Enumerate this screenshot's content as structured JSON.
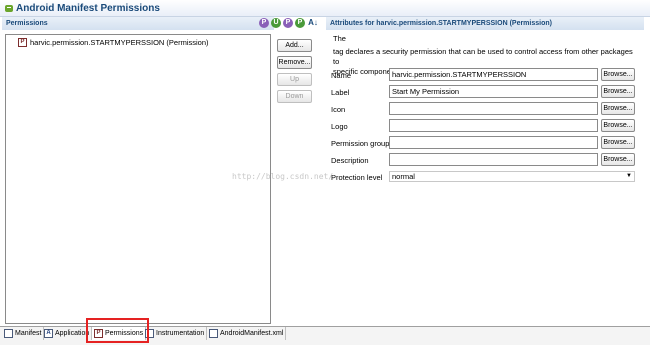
{
  "header": {
    "title": "Android Manifest Permissions"
  },
  "left_panel": {
    "title": "Permissions",
    "badges": [
      "P",
      "U",
      "P",
      "P",
      "A↓"
    ],
    "tree_items": [
      {
        "icon": "P",
        "label": "harvic.permission.STARTMYPERSSION (Permission)"
      }
    ],
    "buttons": {
      "add": "Add...",
      "remove": "Remove...",
      "up": "Up",
      "down": "Down"
    }
  },
  "right_panel": {
    "title": "Attributes for harvic.permission.STARTMYPERSSION (Permission)",
    "desc_line1": "The",
    "desc_line2": "tag declares a security permission that can be used to control access from other packages to",
    "desc_line3": "specific components or features in your package (or other packages).",
    "fields": {
      "name_label": "Name",
      "name_value": "harvic.permission.STARTMYPERSSION",
      "label_label": "Label",
      "label_value": "Start My Permission",
      "icon_label": "Icon",
      "icon_value": "",
      "logo_label": "Logo",
      "logo_value": "",
      "group_label": "Permission group",
      "group_value": "",
      "description_label": "Description",
      "description_value": "",
      "protection_label": "Protection level",
      "protection_value": "normal"
    },
    "browse_label": "Browse..."
  },
  "watermark": "http://blog.csdn.net/",
  "tabs": {
    "manifest": {
      "icon": "",
      "label": "Manifest"
    },
    "application": {
      "icon": "A",
      "label": "Application"
    },
    "permissions": {
      "icon": "P",
      "label": "Permissions"
    },
    "instrumentation": {
      "icon": "",
      "label": "Instrumentation"
    },
    "xml": {
      "icon": "",
      "label": "AndroidManifest.xml"
    }
  }
}
